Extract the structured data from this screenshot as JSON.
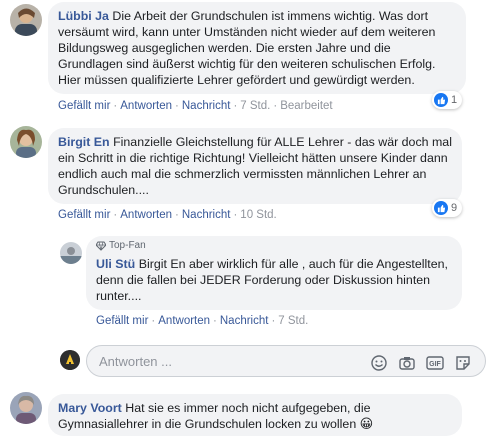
{
  "comments": [
    {
      "author": "Lübbi Ja",
      "text": "Die Arbeit der Grundschulen ist immens wichtig. Was dort versäumt wird, kann unter Umständen nicht wieder auf dem weiteren Bildungsweg ausgeglichen werden. Die ersten Jahre und die Grundlagen sind äußerst wichtig für den weiteren schulischen Erfolg. Hier müssen qualifizierte Lehrer gefördert und gewürdigt werden.",
      "like": "Gefällt mir",
      "reply": "Antworten",
      "message": "Nachricht",
      "time": "7 Std.",
      "edited": "Bearbeitet",
      "reactions": "1"
    },
    {
      "author": "Birgit En",
      "text": "Finanzielle Gleichstellung für ALLE Lehrer - das wär doch mal ein Schritt in die richtige Richtung! Vielleicht hätten unsere Kinder dann endlich auch mal die schmerzlich vermissten männlichen Lehrer an Grundschulen....",
      "like": "Gefällt mir",
      "reply": "Antworten",
      "message": "Nachricht",
      "time": "10 Std.",
      "reactions": "9"
    },
    {
      "author": "Mary Voort",
      "text": "Hat sie es immer noch nicht aufgegeben, die Gymnasiallehrer in die Grundschulen locken zu wollen",
      "emoji": "😀"
    }
  ],
  "reply": {
    "badge": "Top-Fan",
    "author": "Uli Stü",
    "text": "Birgit En aber wirklich für alle , auch für die Angestellten, denn die fallen bei JEDER Forderung oder Diskussion hinten runter....",
    "like": "Gefällt mir",
    "reply": "Antworten",
    "message": "Nachricht",
    "time": "7 Std."
  },
  "composer": {
    "placeholder": "Antworten ...",
    "icons": [
      "emoji-icon",
      "camera-icon",
      "gif-icon",
      "sticker-icon"
    ]
  },
  "colors": {
    "link": "#385898",
    "bubble": "#f2f3f5",
    "like": "#1877f2"
  }
}
